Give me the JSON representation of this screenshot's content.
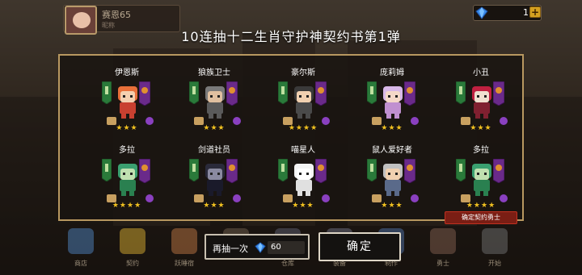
{
  "player": {
    "name": "赛恩65",
    "sub": "昵称"
  },
  "currency": {
    "gems": "1",
    "plus": "+"
  },
  "title": "10连抽十二生肖守护神契约书第1弹",
  "characters": [
    {
      "name": "伊恩斯",
      "stars": "★★★",
      "colors": {
        "hair": "#e8703a",
        "body": "#c84030",
        "skin": "#f4d0b0"
      }
    },
    {
      "name": "狼族卫士",
      "stars": "★★★",
      "colors": {
        "hair": "#7a7a7a",
        "body": "#5a5a5a",
        "skin": "#e0c0a0"
      }
    },
    {
      "name": "豪尔斯",
      "stars": "★★★★",
      "colors": {
        "hair": "#3a3a3a",
        "body": "#4a4a4a",
        "skin": "#f0d0b0"
      }
    },
    {
      "name": "庞莉姆",
      "stars": "★★★",
      "colors": {
        "hair": "#d8b8e8",
        "body": "#c090d0",
        "skin": "#f4d8c8"
      }
    },
    {
      "name": "小丑",
      "stars": "★★★",
      "colors": {
        "hair": "#c02040",
        "body": "#802030",
        "skin": "#f0e0d0"
      }
    },
    {
      "name": "多拉",
      "stars": "★★★★",
      "colors": {
        "hair": "#3aa070",
        "body": "#2a8050",
        "skin": "#c0e0b0"
      }
    },
    {
      "name": "剑道社员",
      "stars": "★★★",
      "colors": {
        "hair": "#2a2a3a",
        "body": "#1a1a2a",
        "skin": "#8a8aa0"
      }
    },
    {
      "name": "喵星人",
      "stars": "★★★",
      "colors": {
        "hair": "#f4f4f4",
        "body": "#e0e0e0",
        "skin": "#ffffff"
      }
    },
    {
      "name": "鼠人爱好者",
      "stars": "★★★",
      "colors": {
        "hair": "#c0c0c0",
        "body": "#5a6a8a",
        "skin": "#f0d0b0"
      }
    },
    {
      "name": "多拉",
      "stars": "★★★★",
      "colors": {
        "hair": "#3aa070",
        "body": "#2a8050",
        "skin": "#c0e0b0"
      }
    }
  ],
  "confirm_tag": "确定契约勇士",
  "nav": [
    {
      "label": "商店",
      "color": "#4a7ab0"
    },
    {
      "label": "契约",
      "color": "#c8a030"
    },
    {
      "label": "跃睡宿",
      "color": "#b07040"
    },
    {
      "label": "",
      "color": "#6a5a48"
    },
    {
      "label": "仓库",
      "color": "#5a5a6a"
    },
    {
      "label": "装备",
      "color": "#6a6a7a"
    },
    {
      "label": "制作",
      "color": "#4a6a9a"
    },
    {
      "label": "勇士",
      "color": "#7a5a4a"
    },
    {
      "label": "开始",
      "color": "#6a6a6a"
    }
  ],
  "buttons": {
    "again_label": "再抽一次",
    "again_cost": "60",
    "confirm_label": "确定"
  },
  "icons": {
    "gem": "diamond-gem-icon",
    "plus": "plus-icon"
  }
}
